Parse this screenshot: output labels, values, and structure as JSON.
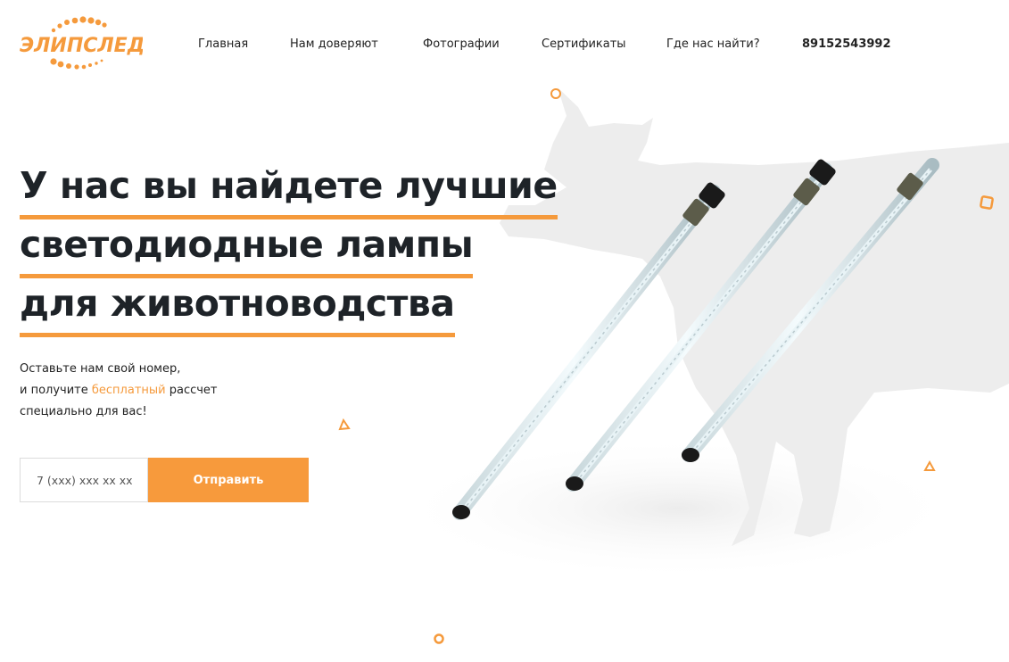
{
  "brand": {
    "name": "ЭЛИПСЛЕД",
    "color": "#f59a3c"
  },
  "nav": {
    "items": [
      "Главная",
      "Нам доверяют",
      "Фотографии",
      "Сертификаты",
      "Где нас найти?"
    ],
    "phone": "89152543992"
  },
  "hero": {
    "headline": [
      "У нас вы найдете лучшие",
      "светодиодные лампы",
      "для животноводства"
    ],
    "lead": {
      "line1": "Оставьте нам свой номер,",
      "line2_before": "и получите ",
      "line2_highlight": "бесплатный",
      "line2_after": " рассчет",
      "line3": "специально для вас!"
    }
  },
  "form": {
    "phone_placeholder": "7 (xxx) xxx xx xx",
    "submit_label": "Отправить"
  },
  "icons": [
    "logo-dots",
    "circle-decor-icon",
    "square-decor-icon",
    "triangle-decor-icon"
  ]
}
